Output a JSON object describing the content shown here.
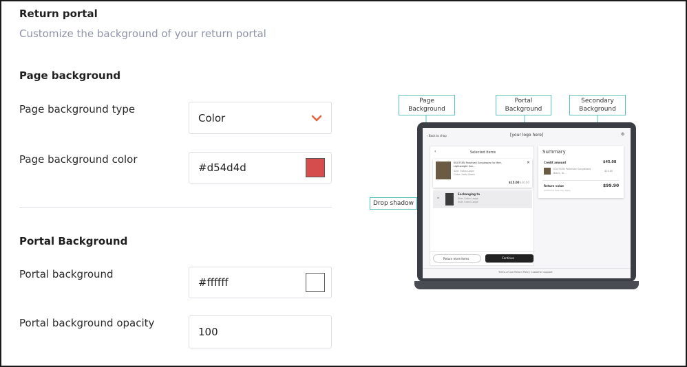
{
  "header": {
    "title": "Return portal",
    "subtitle": "Customize the background of your return portal"
  },
  "page_background": {
    "section_title": "Page background",
    "type_label": "Page background type",
    "type_value": "Color",
    "color_label": "Page background color",
    "color_value": "#d54d4d",
    "swatch_color": "#d54d4d"
  },
  "portal_background": {
    "section_title": "Portal Background",
    "bg_label": "Portal background",
    "bg_value": "#ffffff",
    "swatch_color": "#ffffff",
    "opacity_label": "Portal background opacity",
    "opacity_value": "100"
  },
  "preview": {
    "callouts": {
      "page_background": "Page Background",
      "portal_background": "Portal Background",
      "secondary_background": "Secondary Background",
      "drop_shadow": "Drop shadow"
    },
    "screen": {
      "back": "‹ Back to shop",
      "logo": "[your logo here]",
      "selected_items": "Selected items",
      "product_name": "KOUTSEN Polarised Sunglasses for Men, Lightweight Sun...",
      "product_size": "Size: Extra Large",
      "product_color": "Color: Satin Black",
      "product_price": "$15.00",
      "product_old_price": "$30.00",
      "exchanging": "Exchanging to",
      "exchange_size": "Size: Extra Large",
      "exchange_color": "Size: Extra Large",
      "return_more": "Return more items",
      "continue": "Continue",
      "summary": "Summary",
      "credit_amount": "Credit amount",
      "credit_value": "$45.08",
      "summary_item": "KOUTSEN Polarised Sunglasses",
      "summary_item_sub": "Black, XL",
      "summary_item_price": "$15.00",
      "return_value": "Return value",
      "return_value_amount": "$99.90",
      "return_value_sub": "Additional fees may apply",
      "footer_links": "Terms of use   Return Policy   Customer support"
    }
  }
}
